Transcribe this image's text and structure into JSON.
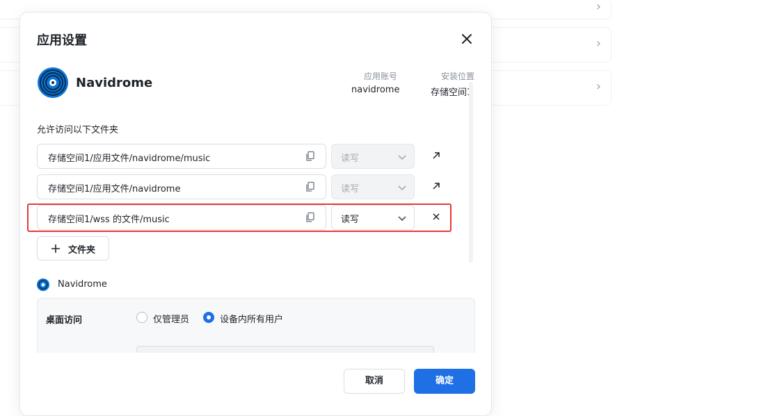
{
  "dialog": {
    "title": "应用设置",
    "close_icon": "close-icon"
  },
  "app": {
    "name": "Navidrome",
    "account_label": "应用账号",
    "account_value": "navidrome",
    "location_label": "安装位置",
    "location_value": "存储空间1"
  },
  "folders": {
    "section_label": "允许访问以下文件夹",
    "rows": [
      {
        "path": "存储空间1/应用文件/navidrome/music",
        "permission": "读写",
        "disabled": true,
        "action_icon": "open-external-icon"
      },
      {
        "path": "存储空间1/应用文件/navidrome",
        "permission": "读写",
        "disabled": true,
        "action_icon": "open-external-icon"
      },
      {
        "path": "存储空间1/wss 的文件/music",
        "permission": "读写",
        "disabled": false,
        "action_icon": "remove-icon"
      }
    ],
    "add_button": "文件夹"
  },
  "access": {
    "app_name": "Navidrome",
    "desktop_label": "桌面访问",
    "options": [
      "仅管理员",
      "设备内所有用户"
    ],
    "selected": "设备内所有用户"
  },
  "footer": {
    "cancel": "取消",
    "confirm": "确定"
  },
  "colors": {
    "accent": "#1f6fe5",
    "highlight": "#e53935"
  }
}
